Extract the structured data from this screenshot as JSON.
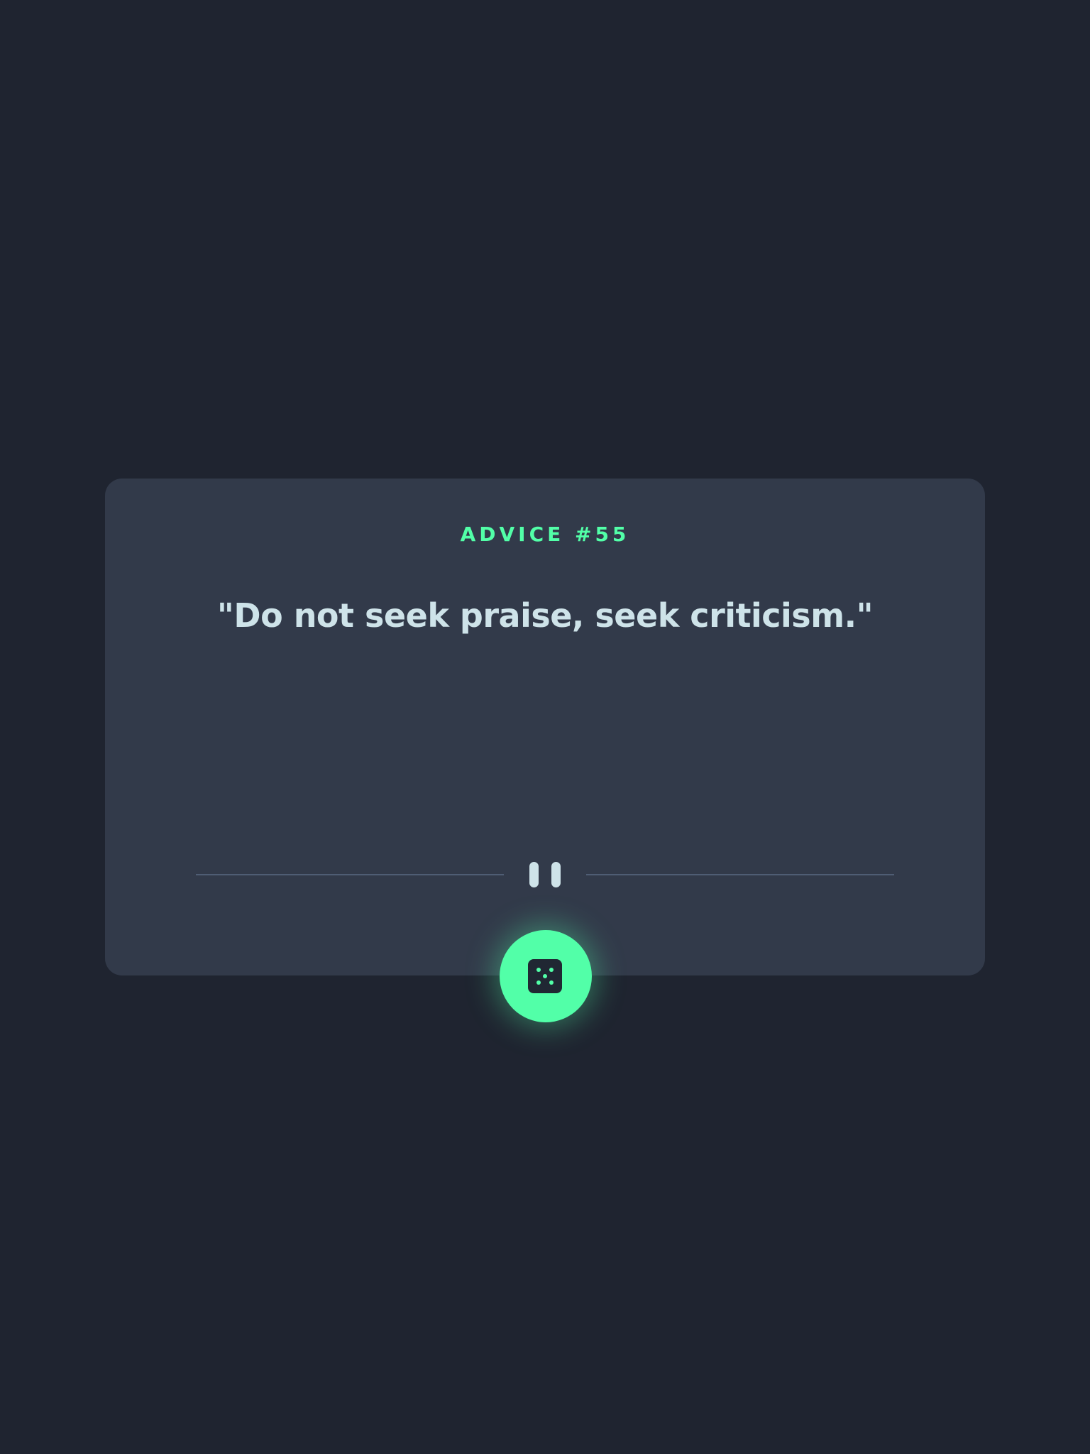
{
  "advice": {
    "id_label": "ADVICE #55",
    "quote": "\"Do not seek praise, seek criticism.\""
  },
  "icons": {
    "divider": "pause-icon",
    "button": "dice-icon"
  },
  "colors": {
    "background": "#1f2430",
    "card": "#323a4a",
    "accent": "#52ffa8",
    "text": "#cee3e9",
    "divider": "#4f5d74"
  }
}
